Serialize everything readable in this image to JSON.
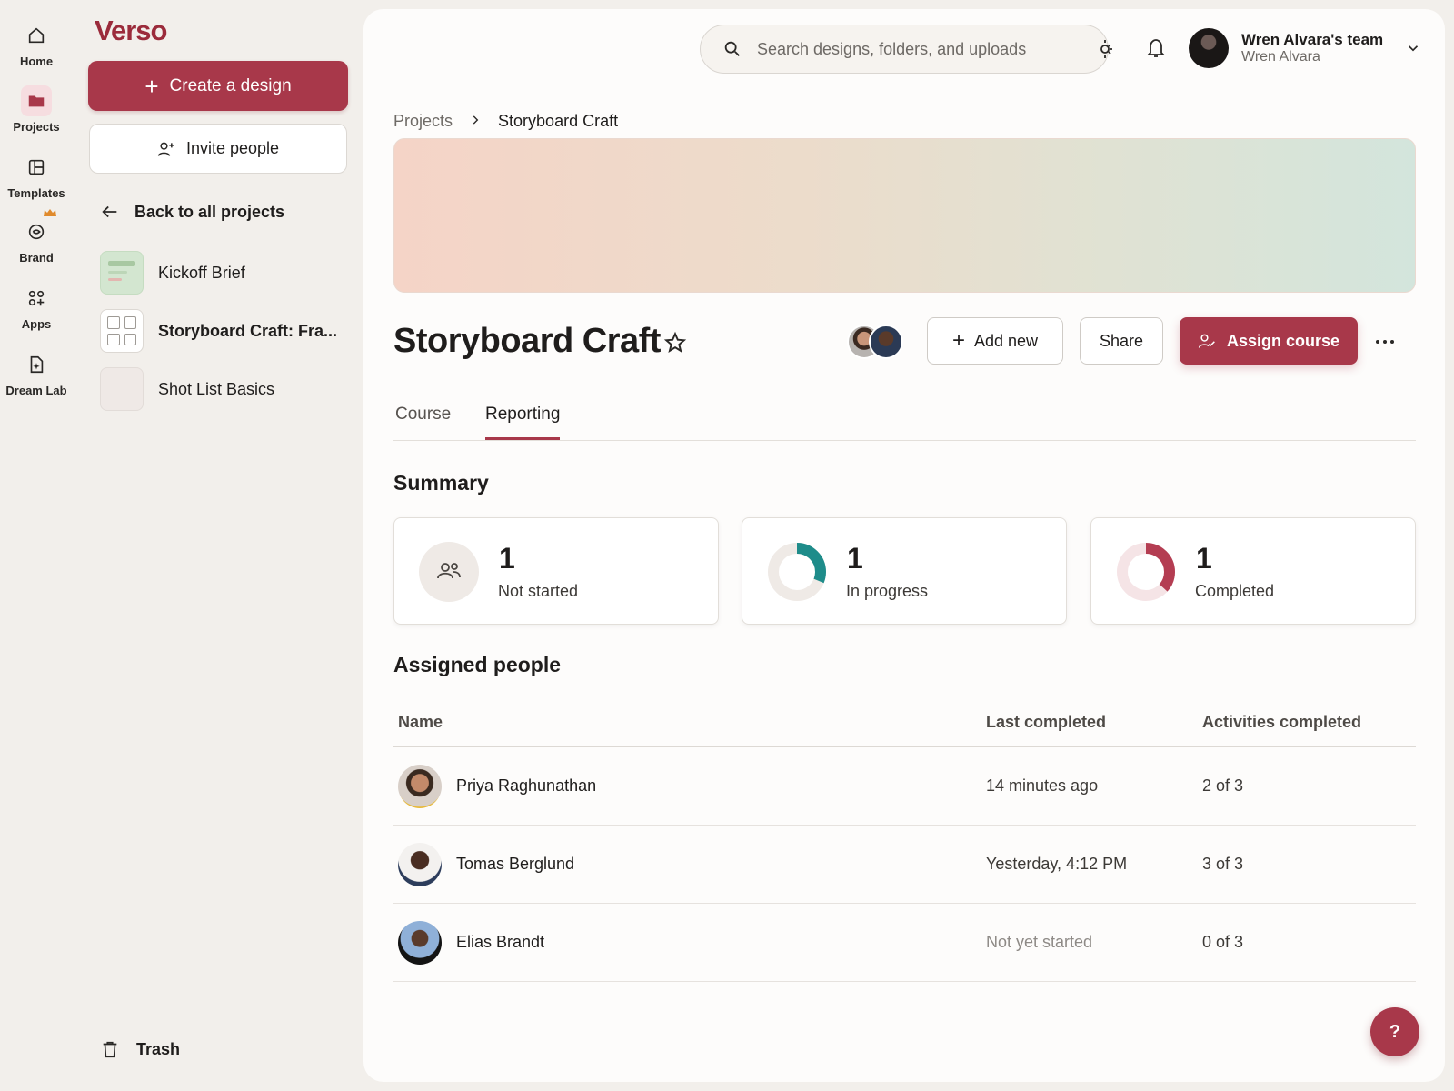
{
  "app": {
    "brand": "Verso",
    "accent": "#A8384A"
  },
  "rail": [
    {
      "label": "Home",
      "icon": "home-icon"
    },
    {
      "label": "Projects",
      "icon": "folder-icon"
    },
    {
      "label": "Templates",
      "icon": "templates-icon"
    },
    {
      "label": "Brand",
      "icon": "brand-icon"
    },
    {
      "label": "Apps",
      "icon": "apps-icon"
    },
    {
      "label": "Dream Lab",
      "icon": "dream-lab-icon"
    }
  ],
  "sidebar": {
    "create_label": "Create a design",
    "invite_label": "Invite people",
    "back_label": "Back to all projects",
    "projects": [
      {
        "label": "Kickoff Brief"
      },
      {
        "label": "Storyboard Craft: Fra..."
      },
      {
        "label": "Shot List Basics"
      }
    ],
    "trash_label": "Trash"
  },
  "header": {
    "search_placeholder": "Search designs, folders, and uploads",
    "account_team": "Wren Alvara's team",
    "account_name": "Wren Alvara"
  },
  "breadcrumb": {
    "parent": "Projects",
    "current": "Storyboard Craft"
  },
  "project": {
    "title": "Storyboard Craft",
    "add_new_label": "Add new",
    "share_label": "Share",
    "assign_label": "Assign course"
  },
  "tabs": [
    {
      "label": "Course"
    },
    {
      "label": "Reporting"
    }
  ],
  "active_tab": "Reporting",
  "summary": {
    "heading": "Summary",
    "cards": [
      {
        "count": "1",
        "label": "Not started"
      },
      {
        "count": "1",
        "label": "In progress"
      },
      {
        "count": "1",
        "label": "Completed"
      }
    ]
  },
  "assigned": {
    "heading": "Assigned people",
    "columns": {
      "name": "Name",
      "last": "Last completed",
      "activities": "Activities completed"
    },
    "rows": [
      {
        "name": "Priya Raghunathan",
        "last": "14 minutes ago",
        "activities": "2 of 3"
      },
      {
        "name": "Tomas Berglund",
        "last": "Yesterday, 4:12 PM",
        "activities": "3 of 3"
      },
      {
        "name": "Elias Brandt",
        "last": "Not yet started",
        "activities": "0 of 3"
      }
    ]
  },
  "help_label": "?"
}
